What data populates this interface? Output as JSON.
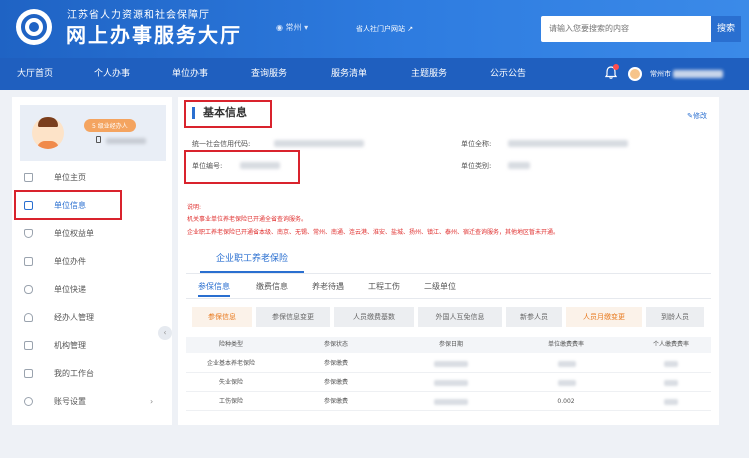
{
  "header": {
    "org_name": "江苏省人力资源和社会保障厅",
    "title": "网上办事服务大厅",
    "city": "常州",
    "city_caret": "▾",
    "portal_link": "省人社门户网站",
    "portal_arrow": "↗",
    "search_placeholder": "请输入您要搜索的内容",
    "search_button": "搜索"
  },
  "nav": {
    "items": [
      "大厅首页",
      "个人办事",
      "单位办事",
      "查询服务",
      "服务清单",
      "主题服务",
      "公示公告"
    ],
    "user_city": "常州市"
  },
  "sidebar": {
    "role_badge": "5 级业经办人",
    "items": [
      {
        "label": "单位主页",
        "icon": "home-icon"
      },
      {
        "label": "单位信息",
        "icon": "info-icon"
      },
      {
        "label": "单位权益单",
        "icon": "shield-icon"
      },
      {
        "label": "单位办件",
        "icon": "file-icon"
      },
      {
        "label": "单位快递",
        "icon": "express-icon"
      },
      {
        "label": "经办人管理",
        "icon": "person-icon"
      },
      {
        "label": "机构管理",
        "icon": "org-icon"
      },
      {
        "label": "我的工作台",
        "icon": "desk-icon"
      },
      {
        "label": "账号设置",
        "icon": "settings-icon"
      }
    ],
    "active_index": 1,
    "collapse_glyph": "‹",
    "chevron_glyph": "›"
  },
  "main": {
    "section_title": "基本信息",
    "edit_label": "✎修改",
    "fields": {
      "credit_code_label": "统一社会信用代码:",
      "unit_number_label": "单位编号:",
      "unit_name_label": "单位全称:",
      "unit_type_label": "单位类别:"
    },
    "notice_title": "说明:",
    "notices": [
      "机关事业单位养老保险已开通全省查询服务。",
      "企业职工养老保险已开通省本级、南京、无锡、常州、南通、连云港、淮安、盐城、扬州、镇江、泰州、宿迁查询服务，其他地区暂未开通。"
    ],
    "big_tab": "企业职工养老保险",
    "sub_tabs": [
      "参保信息",
      "缴费信息",
      "养老待遇",
      "工程工伤",
      "二级单位"
    ],
    "sub_tab_active": 0,
    "button_tabs": [
      "参保信息",
      "参保信息变更",
      "人员缴费基数",
      "外国人互免信息",
      "新参人员",
      "人员月缴变更",
      "到龄人员"
    ],
    "table": {
      "headers": [
        "险种类型",
        "参保状态",
        "参保日期",
        "单位缴费费率",
        "个人缴费费率"
      ],
      "rows": [
        {
          "type": "企业基本养老保险",
          "status": "参保缴费",
          "rate": ""
        },
        {
          "type": "失业保险",
          "status": "参保缴费",
          "rate": ""
        },
        {
          "type": "工伤保险",
          "status": "参保缴费",
          "rate": "0.002"
        }
      ]
    }
  },
  "colors": {
    "header_blue": "#1f63c4",
    "nav_blue": "#1f5fbf",
    "accent": "#2a6fd0",
    "highlight_red": "#d9232d",
    "notice_red": "#e0302f",
    "orange": "#e87a1f"
  }
}
